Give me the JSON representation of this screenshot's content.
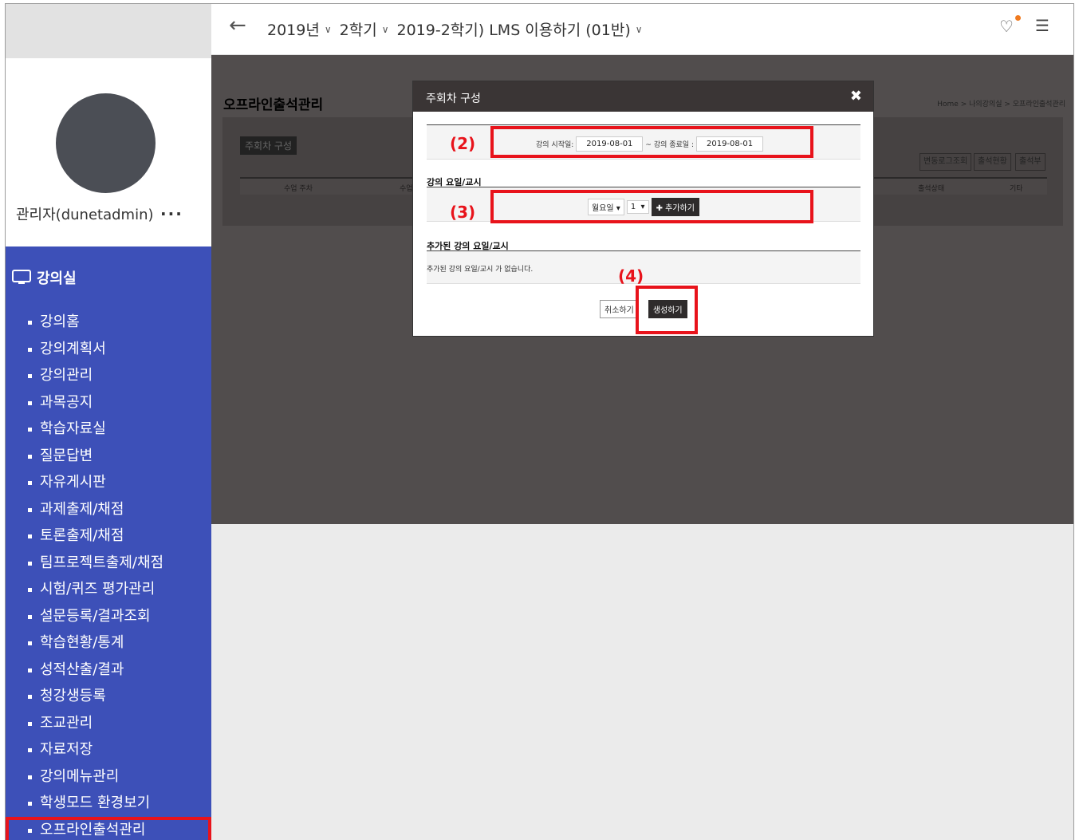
{
  "header": {
    "year": "2019년",
    "semester": "2학기",
    "course": "2019-2학기) LMS 이용하기 (01반)"
  },
  "profile": {
    "name": "관리자(dunetadmin)",
    "more": "..."
  },
  "sidebar": {
    "heading": "강의실",
    "items": [
      "강의홈",
      "강의계획서",
      "강의관리",
      "과목공지",
      "학습자료실",
      "질문답변",
      "자유게시판",
      "과제출제/채점",
      "토론출제/채점",
      "팀프로젝트출제/채점",
      "시험/퀴즈 평가관리",
      "설문등록/결과조회",
      "학습현황/통계",
      "성적산출/결과",
      "청강생등록",
      "조교관리",
      "자료저장",
      "강의메뉴관리",
      "학생모드 환경보기",
      "오프라인출석관리"
    ]
  },
  "page": {
    "title": "오프라인출석관리",
    "breadcrumb": "Home > 나의강의실 > 오프라인출석관리",
    "week_button": "주회차 구성",
    "tools": [
      "변동로그조회",
      "출석현황",
      "출석부"
    ],
    "columns": [
      "수업 주차",
      "수업",
      "출석상태",
      "기타"
    ]
  },
  "modal": {
    "title": "주회차 구성",
    "start_label": "강의 시작일:",
    "start_value": "2019-08-01",
    "end_label": "~ 강의 종료일 :",
    "end_value": "2019-08-01",
    "day_section": "강의 요일/교시",
    "day_select": "월요일",
    "period_select": "1",
    "add_button": "추가하기",
    "added_section": "추가된 강의 요일/교시",
    "empty_msg": "추가된 강의 요일/교시 가 없습니다.",
    "cancel": "취소하기",
    "create": "생성하기"
  },
  "annotations": {
    "a2": "(2)",
    "a3": "(3)",
    "a4": "(4)"
  },
  "colors": {
    "sidebar": "#3d50b8",
    "highlight": "#e8131b",
    "overlay": "#514d4d",
    "notify": "#f07a1f"
  }
}
